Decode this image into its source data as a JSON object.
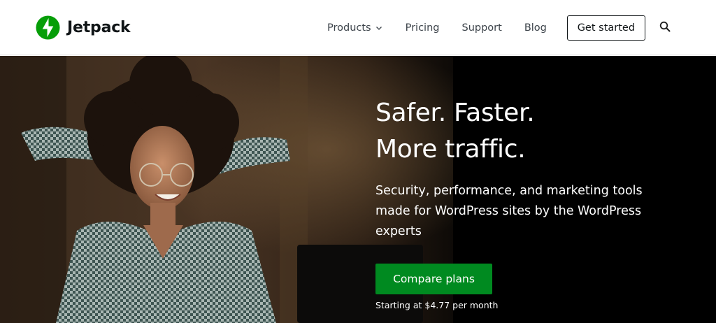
{
  "brand": {
    "name": "Jetpack",
    "accent_color": "#069e08",
    "cta_green": "#008a20"
  },
  "nav": {
    "items": [
      {
        "label": "Products",
        "has_dropdown": true,
        "icon": "chevron-down-icon"
      },
      {
        "label": "Pricing"
      },
      {
        "label": "Support"
      },
      {
        "label": "Blog"
      }
    ],
    "cta_label": "Get started",
    "search_icon": "search-icon"
  },
  "hero": {
    "title_line1": "Safer. Faster.",
    "title_line2": "More traffic.",
    "subtitle": "Security, performance, and marketing tools made for WordPress sites by the WordPress experts",
    "button_label": "Compare plans",
    "price_note": "Starting at $4.77 per month",
    "image": "hero-photo"
  }
}
